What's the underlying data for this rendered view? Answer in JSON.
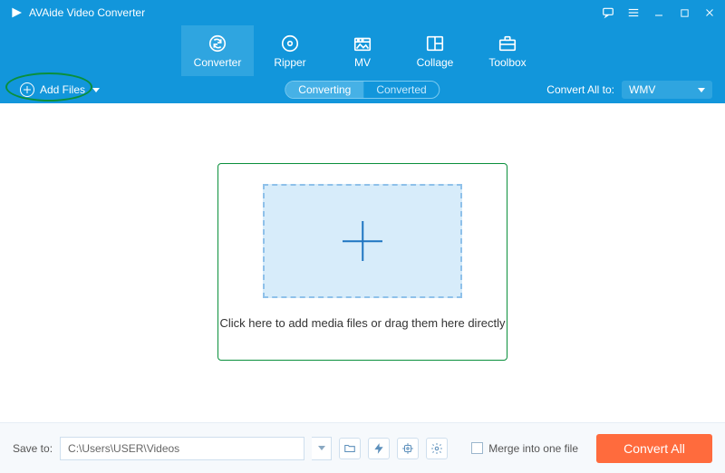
{
  "window": {
    "title": "AVAide Video Converter"
  },
  "tabs": {
    "converter": "Converter",
    "ripper": "Ripper",
    "mv": "MV",
    "collage": "Collage",
    "toolbox": "Toolbox"
  },
  "subbar": {
    "add_files": "Add Files",
    "segment": {
      "converting": "Converting",
      "converted": "Converted"
    },
    "convert_all_to_label": "Convert All to:",
    "format_selected": "WMV"
  },
  "main": {
    "drop_text": "Click here to add media files or drag them here directly"
  },
  "bottom": {
    "save_to_label": "Save to:",
    "save_to_path": "C:\\Users\\USER\\Videos",
    "merge_label": "Merge into one file",
    "convert_btn": "Convert All"
  }
}
